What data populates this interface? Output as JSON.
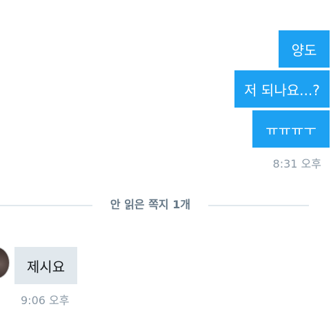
{
  "conversation": {
    "outgoing": [
      {
        "text": "양도"
      },
      {
        "text": "저 되나요...?"
      },
      {
        "text": "ㅠㅠㅠㅜ"
      }
    ],
    "outgoing_time": "8:31 오후",
    "unread_divider": "안 읽은 쪽지 1개",
    "incoming": [
      {
        "text": "제시요"
      }
    ],
    "incoming_time": "9:06 오후"
  },
  "colors": {
    "outgoing_bubble": "#1da1f2",
    "incoming_bubble": "#e1e8ed",
    "timestamp": "#8a98a5",
    "divider_text": "#657786"
  }
}
